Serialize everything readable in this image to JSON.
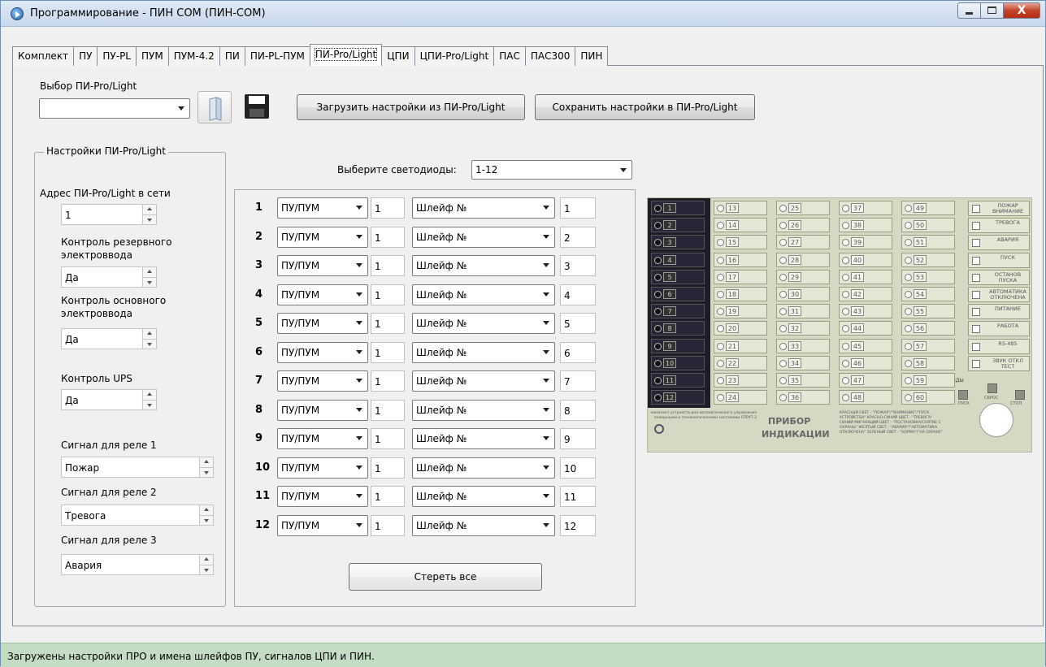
{
  "window": {
    "title": "Программирование - ПИН СОМ (ПИН-СОМ)",
    "close_glyph": "X"
  },
  "tabs": [
    {
      "label": "Комплект"
    },
    {
      "label": "ПУ"
    },
    {
      "label": "ПУ-PL"
    },
    {
      "label": "ПУМ"
    },
    {
      "label": "ПУМ-4.2"
    },
    {
      "label": "ПИ"
    },
    {
      "label": "ПИ-PL-ПУМ"
    },
    {
      "label": "ПИ-Pro/Light",
      "active": true
    },
    {
      "label": "ЦПИ"
    },
    {
      "label": "ЦПИ-Pro/Light"
    },
    {
      "label": "ПАС"
    },
    {
      "label": "ПАС300"
    },
    {
      "label": "ПИН"
    }
  ],
  "top": {
    "select_label": "Выбор ПИ-Pro/Light",
    "select_value": "",
    "load_button": "Загрузить  настройки из ПИ-Pro/Light",
    "save_button": "Сохранить настройки в ПИ-Pro/Light"
  },
  "settings": {
    "group_title": "Настройки ПИ-Pro/Light",
    "address_label": "Адрес ПИ-Pro/Light в сети",
    "address_value": "1",
    "reserve_label_1": "Контроль резервного",
    "reserve_label_2": "электроввода",
    "reserve_value": "Да",
    "main_label_1": "Контроль основного",
    "main_label_2": "электроввода",
    "main_value": "Да",
    "ups_label": "Контроль UPS",
    "ups_value": "Да",
    "relay1_label": "Сигнал для реле 1",
    "relay1_value": "Пожар",
    "relay2_label": "Сигнал для реле 2",
    "relay2_value": "Тревога",
    "relay3_label": "Сигнал для реле 3",
    "relay3_value": "Авария"
  },
  "leds": {
    "select_label": "Выберите светодиоды:",
    "select_value": "1-12",
    "rows": [
      {
        "num": "1",
        "device": "ПУ/ПУМ",
        "device_no": "1",
        "type": "Шлейф №",
        "type_no": "1"
      },
      {
        "num": "2",
        "device": "ПУ/ПУМ",
        "device_no": "1",
        "type": "Шлейф №",
        "type_no": "2"
      },
      {
        "num": "3",
        "device": "ПУ/ПУМ",
        "device_no": "1",
        "type": "Шлейф №",
        "type_no": "3"
      },
      {
        "num": "4",
        "device": "ПУ/ПУМ",
        "device_no": "1",
        "type": "Шлейф №",
        "type_no": "4"
      },
      {
        "num": "5",
        "device": "ПУ/ПУМ",
        "device_no": "1",
        "type": "Шлейф №",
        "type_no": "5"
      },
      {
        "num": "6",
        "device": "ПУ/ПУМ",
        "device_no": "1",
        "type": "Шлейф №",
        "type_no": "6"
      },
      {
        "num": "7",
        "device": "ПУ/ПУМ",
        "device_no": "1",
        "type": "Шлейф №",
        "type_no": "7"
      },
      {
        "num": "8",
        "device": "ПУ/ПУМ",
        "device_no": "1",
        "type": "Шлейф №",
        "type_no": "8"
      },
      {
        "num": "9",
        "device": "ПУ/ПУМ",
        "device_no": "1",
        "type": "Шлейф №",
        "type_no": "9"
      },
      {
        "num": "10",
        "device": "ПУ/ПУМ",
        "device_no": "1",
        "type": "Шлейф №",
        "type_no": "10"
      },
      {
        "num": "11",
        "device": "ПУ/ПУМ",
        "device_no": "1",
        "type": "Шлейф №",
        "type_no": "11"
      },
      {
        "num": "12",
        "device": "ПУ/ПУМ",
        "device_no": "1",
        "type": "Шлейф №",
        "type_no": "12"
      }
    ],
    "clear_button": "Стереть все"
  },
  "indicator": {
    "led_numbers": [
      "1",
      "2",
      "3",
      "4",
      "5",
      "6",
      "7",
      "8",
      "9",
      "10",
      "11",
      "12",
      "13",
      "14",
      "15",
      "16",
      "17",
      "18",
      "19",
      "20",
      "21",
      "22",
      "23",
      "24",
      "25",
      "26",
      "27",
      "28",
      "29",
      "30",
      "31",
      "32",
      "33",
      "34",
      "35",
      "36",
      "37",
      "38",
      "39",
      "40",
      "41",
      "42",
      "43",
      "44",
      "45",
      "46",
      "47",
      "48",
      "49",
      "50",
      "51",
      "52",
      "53",
      "54",
      "55",
      "56",
      "57",
      "58",
      "59",
      "60"
    ],
    "signals": [
      "ПОЖАР ВНИМАНИЕ",
      "ТРЕВОГА",
      "АВАРИЯ",
      "ПУСК",
      "ОСТАНОВ ПУСКА",
      "АВТОМАТИКА ОТКЛЮЧЕНА",
      "ПИТАНИЕ",
      "РАБОТА",
      "RS-485",
      "ЗВУК ОТКЛ ТЕСТ"
    ],
    "commands_label": "КОМАНДЫ",
    "cmd_start": "ПУСК",
    "cmd_reset": "СБРОС",
    "cmd_stop": "СТОП",
    "name_1": "ПРИБОР",
    "name_2": "ИНДИКАЦИИ",
    "left_text": "комплект устройств для автоматического управления пожарными и технологическими системами СПРУТ-2",
    "right_text": "КРАСНЫЙ СВЕТ - \"ПОЖАР\"/\"ВНИМАНИЕ\"/\"ПУСК УСТРОЙСТВА\" КРАСНО-СИНИЙ ЦВЕТ - \"ТРЕВОГА\" СИНИЙ МИГАЮЩИЙ ЦВЕТ - \"ПОСТАНОВКА/СНЯТИЕ С ОХРАНЫ\" ЖЕЛТЫЙ СВЕТ - \"АВАРИЯ\"/\"АВТОМАТИКА ОТКЛЮЧЕНА\" ЗЕЛЕНЫЙ СВЕТ - \"НОРМА\"/\"НА ОХРАНЕ\""
  },
  "status": {
    "text": "Загружены настройки ПРО и имена шлейфов ПУ, сигналов ЦПИ и ПИН."
  }
}
